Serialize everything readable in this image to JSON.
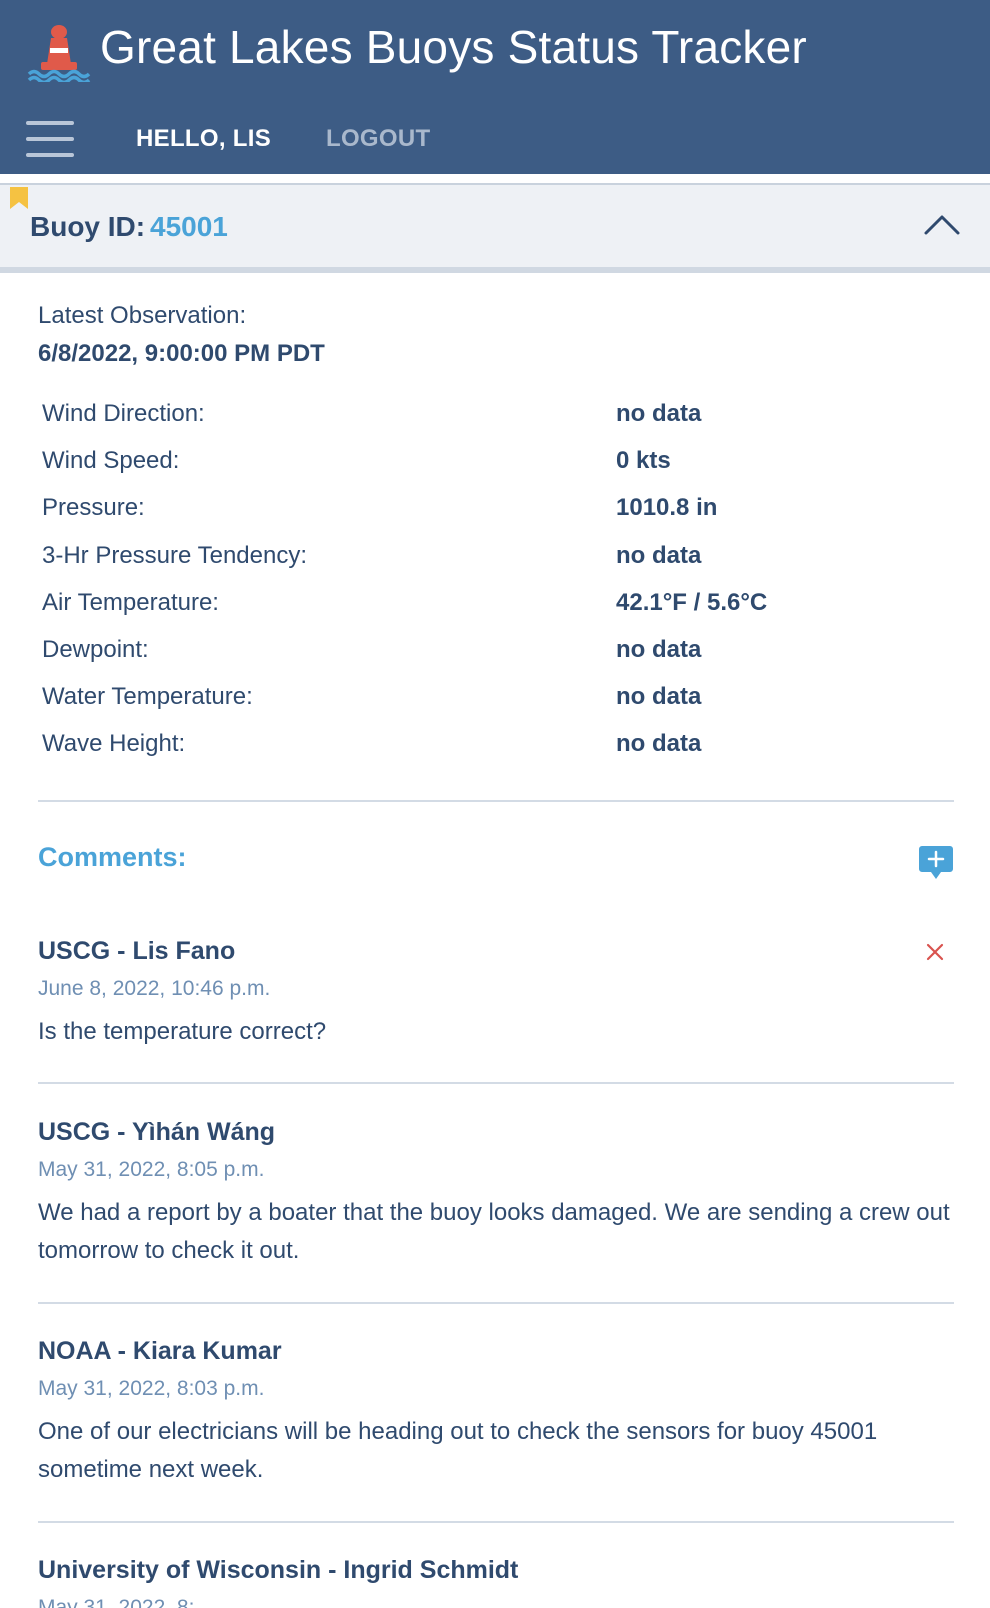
{
  "app": {
    "title": "Great Lakes Buoys Status Tracker",
    "accent_color": "#3d5c85",
    "logo_icon": "buoy-icon"
  },
  "nav": {
    "menu_icon": "hamburger-menu-icon",
    "greeting": "HELLO, LIS",
    "logout": "LOGOUT"
  },
  "buoy": {
    "label": "Buoy ID:",
    "id": "45001",
    "bookmarked": true
  },
  "observation": {
    "label": "Latest Observation:",
    "timestamp": "6/8/2022, 9:00:00 PM PDT",
    "rows": [
      {
        "name": "Wind Direction:",
        "value": "no data"
      },
      {
        "name": "Wind Speed:",
        "value": "0 kts"
      },
      {
        "name": "Pressure:",
        "value": "1010.8 in"
      },
      {
        "name": "3-Hr Pressure Tendency:",
        "value": "no data"
      },
      {
        "name": "Air Temperature:",
        "value": "42.1°F / 5.6°C"
      },
      {
        "name": "Dewpoint:",
        "value": "no data"
      },
      {
        "name": "Water Temperature:",
        "value": "no data"
      },
      {
        "name": "Wave Height:",
        "value": "no data"
      }
    ]
  },
  "comments": {
    "title": "Comments:",
    "items": [
      {
        "author": "USCG - Lis Fano",
        "date": "June 8, 2022, 10:46 p.m.",
        "text": "Is the temperature correct?",
        "deletable": true
      },
      {
        "author": "USCG - Yìhán Wáng",
        "date": "May 31, 2022, 8:05 p.m.",
        "text": "We had a report by a boater that the buoy looks damaged. We are sending a crew out tomorrow to check it out."
      },
      {
        "author": "NOAA - Kiara Kumar",
        "date": "May 31, 2022, 8:03 p.m.",
        "text": "One of our electricians will be heading out to check the sensors for buoy 45001 sometime next week."
      },
      {
        "author": "University of Wisconsin - Ingrid Schmidt",
        "date": "May 31, 2022, 8:...",
        "text": ""
      }
    ]
  }
}
